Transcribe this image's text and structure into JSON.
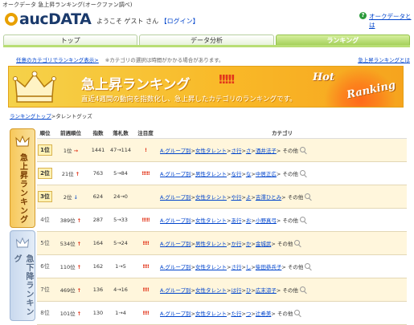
{
  "page_header": "オークデータ 急上昇ランキング(オークファン調べ)",
  "brand": {
    "logo": "aucDATA"
  },
  "welcome": {
    "text": "ようこそ ゲスト さん",
    "login": "【ログイン】"
  },
  "help": {
    "icon": "?",
    "label": "オークデータとは"
  },
  "tabs": [
    {
      "label": "トップ",
      "active": false
    },
    {
      "label": "データ分析",
      "active": false
    },
    {
      "label": "ランキング",
      "active": true
    }
  ],
  "subnav": {
    "link": "任意のカテゴリでランキング表示>",
    "note": "※カテゴリの選択は時間がかかる場合があります。",
    "right_link": "急上昇ランキングとは"
  },
  "banner": {
    "title": "急上昇ランキング",
    "marks": "!!!!!",
    "subtitle": "直近4週間の動向を指数化し、急上昇したカテゴリのランキングです。",
    "hot": "Hot",
    "ranking": "Ranking"
  },
  "breadcrumb": {
    "link": "ランキングトップ",
    "sep": ">",
    "current": "タレントグッズ"
  },
  "side_tabs": {
    "up": "急上昇ランキング",
    "down": "急下降ランキング"
  },
  "columns": [
    "順位",
    "前週順位",
    "指数",
    "落札数",
    "注目度",
    "カテゴリ"
  ],
  "rows": [
    {
      "rank": "1位",
      "prev": "1位",
      "trend": "→",
      "index": "1441",
      "bids": "47→114",
      "attention": "!",
      "cat": [
        "A.",
        "グループ別",
        "女性タレント",
        "さ行",
        "さ",
        "酒井法子"
      ],
      "other": "その他"
    },
    {
      "rank": "2位",
      "prev": "21位",
      "trend": "↑",
      "index": "763",
      "bids": "5→84",
      "attention": "!!!!!",
      "cat": [
        "A.",
        "グループ別",
        "男性タレント",
        "な行",
        "な",
        "中居正広"
      ],
      "other": "その他"
    },
    {
      "rank": "3位",
      "prev": "2位",
      "trend": "↓",
      "index": "624",
      "bids": "24→0",
      "attention": "",
      "cat": [
        "A.",
        "グループ別",
        "女性タレント",
        "や行",
        "よ",
        "吉澤ひとみ"
      ],
      "other": "その他"
    },
    {
      "rank": "4位",
      "prev": "389位",
      "trend": "↑",
      "index": "287",
      "bids": "5→33",
      "attention": "!!!!!",
      "cat": [
        "A.",
        "グループ別",
        "女性タレント",
        "あ行",
        "お",
        "小野真弓"
      ],
      "other": "その他"
    },
    {
      "rank": "5位",
      "prev": "534位",
      "trend": "↑",
      "index": "164",
      "bids": "5→24",
      "attention": "!!!!",
      "cat": [
        "A.",
        "グループ別",
        "男性タレント",
        "か行",
        "か",
        "金城武"
      ],
      "other": "その他"
    },
    {
      "rank": "6位",
      "prev": "110位",
      "trend": "↑",
      "index": "162",
      "bids": "1→5",
      "attention": "!!!!",
      "cat": [
        "A.",
        "グループ別",
        "女性タレント",
        "さ行",
        "し",
        "柴田恭兵子"
      ],
      "other": "その他"
    },
    {
      "rank": "7位",
      "prev": "469位",
      "trend": "↑",
      "index": "136",
      "bids": "4→16",
      "attention": "!!!!",
      "cat": [
        "A.",
        "グループ別",
        "女性タレント",
        "は行",
        "ひ",
        "広末涼子"
      ],
      "other": "その他"
    },
    {
      "rank": "8位",
      "prev": "101位",
      "trend": "↑",
      "index": "130",
      "bids": "1→4",
      "attention": "!!!!",
      "cat": [
        "A.",
        "グループ別",
        "女性タレント",
        "た行",
        "つ",
        "辻希美"
      ],
      "other": "その他"
    }
  ]
}
